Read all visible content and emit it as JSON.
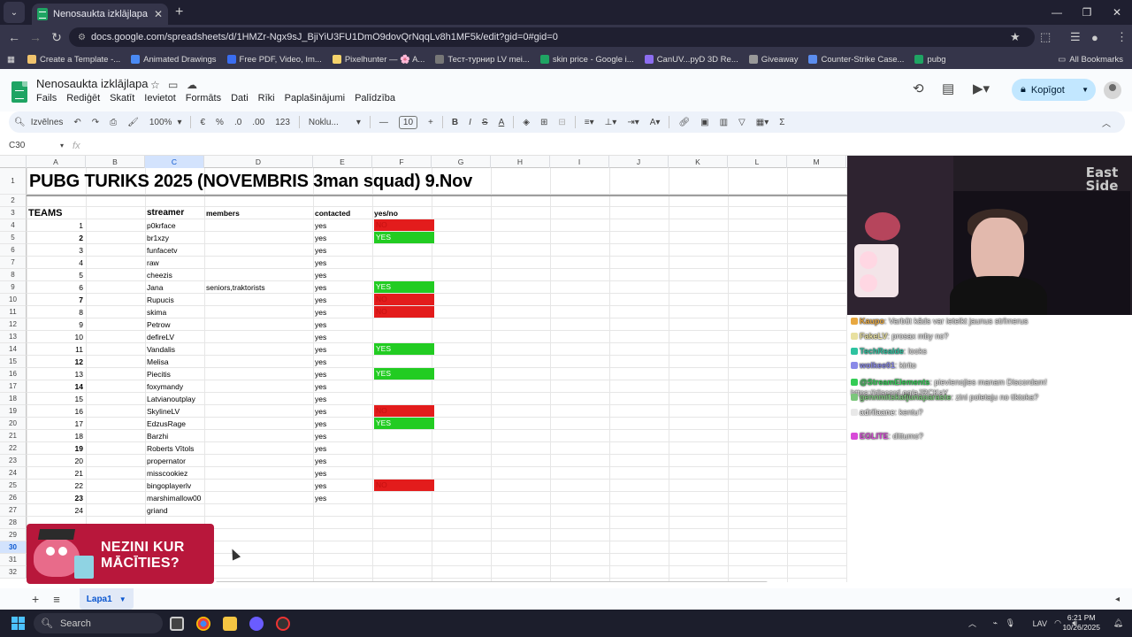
{
  "browser": {
    "tab_title": "Nenosaukta izklājlapa - Google",
    "url": "docs.google.com/spreadsheets/d/1HMZr-Ngx9sJ_BjiYiU3FU1DmO9dovQrNqqLv8h1MF5k/edit?gid=0#gid=0",
    "bookmarks": [
      {
        "label": "Create a Template -...",
        "color": "#f0c36d"
      },
      {
        "label": "Animated Drawings",
        "color": "#4a8af4"
      },
      {
        "label": "Free PDF, Video, Im...",
        "color": "#3a6df0"
      },
      {
        "label": "Pixelhunter — 🌸 A...",
        "color": "#f5d36b"
      },
      {
        "label": "Тест-турнир LV mei...",
        "color": "#777777"
      },
      {
        "label": "skin price - Google i...",
        "color": "#1fa463"
      },
      {
        "label": "CanUV...pyD 3D Re...",
        "color": "#8c6df0"
      },
      {
        "label": "Giveaway",
        "color": "#999999"
      },
      {
        "label": "Counter-Strike Case...",
        "color": "#5b8dee"
      },
      {
        "label": "pubg",
        "color": "#1fa463"
      }
    ],
    "all_bookmarks": "All Bookmarks"
  },
  "sheets": {
    "doc_title": "Nenosaukta izklājlapa",
    "menu": [
      "Fails",
      "Rediģēt",
      "Skatīt",
      "Ievietot",
      "Formāts",
      "Dati",
      "Rīki",
      "Paplašinājumi",
      "Palīdzība"
    ],
    "share_label": "Kopīgot",
    "toolbar": {
      "search": "Izvēlnes",
      "zoom": "100%",
      "currency": "€",
      "percent": "%",
      "dec_dec": ".0",
      "dec_inc": ".00",
      "numfmt": "123",
      "font": "Noklu...",
      "font_size": "10"
    },
    "cell_ref": "C30",
    "fx": "fx",
    "columns": [
      "A",
      "B",
      "C",
      "D",
      "E",
      "F",
      "G",
      "H",
      "I",
      "J",
      "K",
      "L",
      "M"
    ],
    "row_numbers": [
      "1",
      "2",
      "3",
      "4",
      "5",
      "6",
      "7",
      "8",
      "9",
      "10",
      "11",
      "12",
      "13",
      "14",
      "15",
      "16",
      "17",
      "18",
      "19",
      "20",
      "21",
      "22",
      "23",
      "24",
      "25",
      "26",
      "27",
      "28",
      "29",
      "30",
      "31",
      "32"
    ],
    "title_cell": "PUBG TURIKS 2025 (NOVEMBRIS 3man squad) 9.Nov",
    "headers": {
      "teams": "TEAMS",
      "streamer": "streamer",
      "members": "members",
      "contacted": "contacted",
      "yes_no": "yes/no"
    },
    "rows": [
      {
        "n": "1",
        "bold": false,
        "streamer": "p0krface",
        "members": "",
        "contacted": "yes",
        "status": "NO"
      },
      {
        "n": "2",
        "bold": true,
        "streamer": "br1xzy",
        "members": "",
        "contacted": "yes",
        "status": "YES"
      },
      {
        "n": "3",
        "bold": false,
        "streamer": "funfacetv",
        "members": "",
        "contacted": "yes",
        "status": ""
      },
      {
        "n": "4",
        "bold": false,
        "streamer": "raw",
        "members": "",
        "contacted": "yes",
        "status": ""
      },
      {
        "n": "5",
        "bold": false,
        "streamer": "cheezis",
        "members": "",
        "contacted": "yes",
        "status": ""
      },
      {
        "n": "6",
        "bold": false,
        "streamer": "Jana",
        "members": "seniors,traktorists",
        "contacted": "yes",
        "status": "YES"
      },
      {
        "n": "7",
        "bold": true,
        "streamer": "Rupucis",
        "members": "",
        "contacted": "yes",
        "status": "NO"
      },
      {
        "n": "8",
        "bold": false,
        "streamer": "skima",
        "members": "",
        "contacted": "yes",
        "status": "NO"
      },
      {
        "n": "9",
        "bold": false,
        "streamer": "Petrow",
        "members": "",
        "contacted": "yes",
        "status": ""
      },
      {
        "n": "10",
        "bold": false,
        "streamer": "defireLV",
        "members": "",
        "contacted": "yes",
        "status": ""
      },
      {
        "n": "11",
        "bold": false,
        "streamer": "Vandalis",
        "members": "",
        "contacted": "yes",
        "status": "YES"
      },
      {
        "n": "12",
        "bold": true,
        "streamer": "Melisa",
        "members": "",
        "contacted": "yes",
        "status": ""
      },
      {
        "n": "13",
        "bold": false,
        "streamer": "Piecitis",
        "members": "",
        "contacted": "yes",
        "status": "YES"
      },
      {
        "n": "14",
        "bold": true,
        "streamer": "foxymandy",
        "members": "",
        "contacted": "yes",
        "status": ""
      },
      {
        "n": "15",
        "bold": false,
        "streamer": "Latvianoutplay",
        "members": "",
        "contacted": "yes",
        "status": ""
      },
      {
        "n": "16",
        "bold": false,
        "streamer": "SkylineLV",
        "members": "",
        "contacted": "yes",
        "status": "NO"
      },
      {
        "n": "17",
        "bold": false,
        "streamer": "EdzusRage",
        "members": "",
        "contacted": "yes",
        "status": "YES"
      },
      {
        "n": "18",
        "bold": false,
        "streamer": "Barzhi",
        "members": "",
        "contacted": "yes",
        "status": ""
      },
      {
        "n": "19",
        "bold": true,
        "streamer": "Roberts Vītols",
        "members": "",
        "contacted": "yes",
        "status": ""
      },
      {
        "n": "20",
        "bold": false,
        "streamer": "propernator",
        "members": "",
        "contacted": "yes",
        "status": ""
      },
      {
        "n": "21",
        "bold": false,
        "streamer": "misscookiez",
        "members": "",
        "contacted": "yes",
        "status": ""
      },
      {
        "n": "22",
        "bold": false,
        "streamer": "bingoplayerlv",
        "members": "",
        "contacted": "yes",
        "status": "NO"
      },
      {
        "n": "23",
        "bold": true,
        "streamer": "marshimallow00",
        "members": "",
        "contacted": "yes",
        "status": ""
      },
      {
        "n": "24",
        "bold": false,
        "streamer": "griand",
        "members": "",
        "contacted": "",
        "status": ""
      }
    ],
    "sheet_tab": "Lapa1",
    "ad": {
      "line1": "NEZINI KUR",
      "line2": "MĀCĪTIES?"
    }
  },
  "colors": {
    "no": "#e31c1c",
    "yes": "#22cc22",
    "accent": "#0b57d0"
  },
  "stream": {
    "cam_sign": "East Side",
    "chat": [
      {
        "user": "Kaupo",
        "text": ": Varbūt kāds var ieteikt jaunus strīmerus",
        "color": "#e8a840"
      },
      {
        "user": "FakeLV",
        "text": ": prosax mby no?",
        "color": "#e8e0a0"
      },
      {
        "user": "TechRealde",
        "text": ": looks",
        "color": "#2ec3a0"
      },
      {
        "user": "wolkee01",
        "text": ": kirito",
        "color": "#8a8ae8"
      },
      {
        "user": "@StreamElements",
        "text": ": pievienojies manam Discordam! https://discord.gg/aJRCKsY",
        "color": "#33cc55"
      },
      {
        "user": "gennmitskatjunaparaste",
        "text": ": zini poletaju no tiktoka?",
        "color": "#7cc67c"
      },
      {
        "user": "adrilaane",
        "text": ": kentu?",
        "color": "#e8e8e8"
      },
      {
        "user": "EGLITE",
        "text": ": dittumo?",
        "color": "#d84ad8"
      }
    ]
  },
  "taskbar": {
    "search": "Search",
    "lang": "LAV",
    "time": "6:21 PM",
    "date": "10/26/2025"
  }
}
